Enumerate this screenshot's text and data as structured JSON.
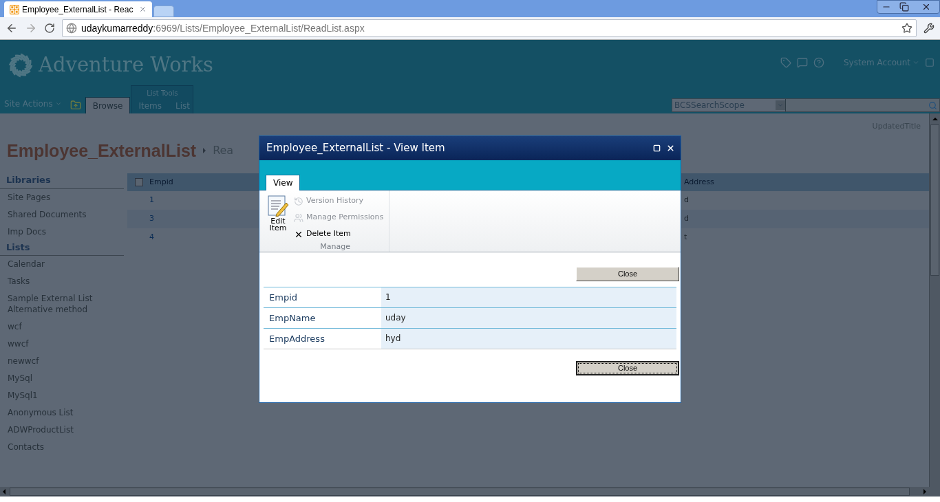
{
  "browser": {
    "tabs": [
      {
        "title": "Employee_ExternalList - Reac",
        "selected": true
      },
      {
        "selected": false
      }
    ],
    "address": {
      "host": "udaykumarreddy",
      "path": ":6969/Lists/Employee_ExternalList/ReadList.aspx"
    }
  },
  "header": {
    "site_title": "Adventure Works",
    "user": "System Account"
  },
  "ribbon": {
    "site_actions": "Site Actions",
    "group_label": "List Tools",
    "tabs": [
      {
        "label": "Browse",
        "selected": true
      },
      {
        "label": "Items",
        "selected": false
      },
      {
        "label": "List",
        "selected": false
      }
    ],
    "search_scope": "BCSSearchScope"
  },
  "page": {
    "updated_title": "UpdatedTitle",
    "title": "Employee_ExternalList",
    "breadcrumb_next": "Rea"
  },
  "quick_launch": [
    {
      "heading": "Libraries",
      "items": [
        "Site Pages",
        "Shared Documents",
        "Imp Docs"
      ]
    },
    {
      "heading": "Lists",
      "items": [
        "Calendar",
        "Tasks",
        "Sample External List Alternative method",
        "wcf",
        "wwcf",
        "newwcf",
        "MySql",
        "MySql1",
        "Anonymous List",
        "ADWProductList",
        "Contacts"
      ]
    }
  ],
  "list": {
    "select_all_checked": false,
    "columns": [
      "Empid",
      "Address"
    ],
    "rows": [
      [
        "1",
        "d"
      ],
      [
        "3",
        "d"
      ],
      [
        "4",
        "t"
      ]
    ]
  },
  "dialog": {
    "title": "Employee_ExternalList - View Item",
    "tabs": [
      {
        "label": "View",
        "selected": true
      }
    ],
    "actions": [
      {
        "kind": "large",
        "label": "Edit Item",
        "disabled": false
      },
      {
        "kind": "small",
        "label": "Version History",
        "disabled": true
      },
      {
        "kind": "small",
        "label": "Manage Permissions",
        "disabled": true
      },
      {
        "kind": "small",
        "label": "Delete Item",
        "disabled": false
      }
    ],
    "group_label": "Manage",
    "close_buttons": [
      "Close",
      "Close"
    ],
    "fields": [
      {
        "label": "Empid",
        "value": "1"
      },
      {
        "label": "EmpName",
        "value": "uday"
      },
      {
        "label": "EmpAddress",
        "value": "hyd"
      }
    ]
  }
}
